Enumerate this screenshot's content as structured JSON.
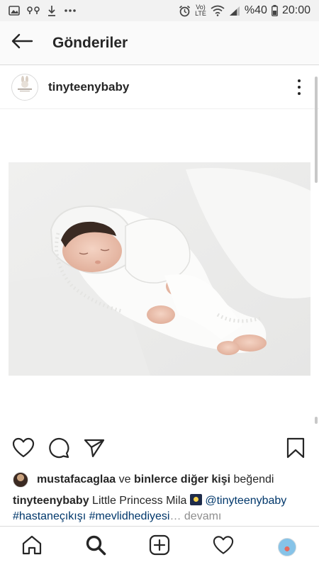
{
  "status_bar": {
    "network_top": "Vo)",
    "network_bottom": "LTE",
    "battery_percent": "%40",
    "time": "20:00",
    "icons": [
      "gallery-icon",
      "voicemail-icon",
      "download-icon",
      "more-icon",
      "alarm-icon",
      "wifi-icon",
      "signal-icon",
      "battery-icon"
    ]
  },
  "header": {
    "title": "Gönderiler",
    "back_icon": "arrow-left-icon"
  },
  "post": {
    "username": "tinyteenybaby",
    "avatar_icon": "bunny-logo-icon",
    "more_icon": "vertical-dots-icon",
    "photo_description_icon": "sleeping-baby-photo"
  },
  "actions": {
    "icons": [
      "heart-icon",
      "comment-icon",
      "send-icon",
      "bookmark-icon"
    ]
  },
  "likes": {
    "liker": "mustafacaglaa",
    "connector": "ve",
    "others": "binlerce diğer kişi",
    "suffix": "beğendi"
  },
  "caption": {
    "author": "tinyteenybaby",
    "text": "Little Princess Mila",
    "mention": "@tinyteenybaby",
    "hashtags": "#hastaneçıkışı #mevlidhediyesi",
    "ellipsis": "…",
    "more_label": "devamı"
  },
  "bottom_nav": {
    "items": [
      "home-icon",
      "search-icon",
      "new-post-icon",
      "activity-icon",
      "profile-avatar"
    ]
  },
  "colors": {
    "text": "#262626",
    "link": "#00376b",
    "muted": "#8e8e8e",
    "header_bg": "#fafafa",
    "status_bg": "#f2f2f2"
  }
}
